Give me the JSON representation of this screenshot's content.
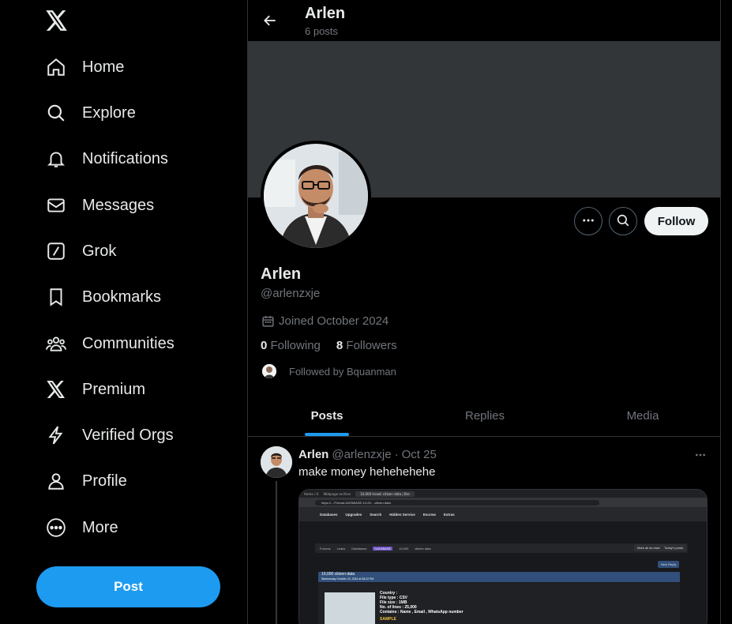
{
  "sidebar": {
    "logo": "x-logo-icon",
    "items": [
      {
        "label": "Home",
        "icon": "home-icon"
      },
      {
        "label": "Explore",
        "icon": "search-icon"
      },
      {
        "label": "Notifications",
        "icon": "bell-icon"
      },
      {
        "label": "Messages",
        "icon": "envelope-icon"
      },
      {
        "label": "Grok",
        "icon": "grok-icon"
      },
      {
        "label": "Bookmarks",
        "icon": "bookmark-icon"
      },
      {
        "label": "Communities",
        "icon": "communities-icon"
      },
      {
        "label": "Premium",
        "icon": "x-logo-icon"
      },
      {
        "label": "Verified Orgs",
        "icon": "lightning-icon"
      },
      {
        "label": "Profile",
        "icon": "person-icon"
      },
      {
        "label": "More",
        "icon": "more-circle-icon"
      }
    ],
    "post_label": "Post"
  },
  "header": {
    "name": "Arlen",
    "posts_count": "6 posts"
  },
  "profile": {
    "name": "Arlen",
    "handle": "@arlenzxje",
    "joined": "Joined October 2024",
    "following_count": "0",
    "following_label": "Following",
    "followers_count": "8",
    "followers_label": "Followers",
    "followed_by": "Followed by Bquanman",
    "follow_label": "Follow"
  },
  "tabs": [
    {
      "label": "Posts",
      "active": true
    },
    {
      "label": "Replies",
      "active": false
    },
    {
      "label": "Media",
      "active": false
    }
  ],
  "tweet": {
    "name": "Arlen",
    "handle": "@arlenzxje",
    "separator": "·",
    "date": "Oct 25",
    "text": "make money hehehehehe"
  },
  "media": {
    "browser_tabs": [
      "Home / X",
      "Webpage archive",
      "10,000 Israeli citizen data | Bre"
    ],
    "url": "https://.../Thread-DATABASE-10-00... citizen-data",
    "nav_items": [
      "Databases",
      "Upgrades",
      "Search",
      "Hidden Service",
      "Escrow",
      "Extras"
    ],
    "breadcrumb": [
      "Forums",
      "Leaks",
      "Databases",
      "DATABASE",
      "10,000",
      "citizen data"
    ],
    "mark_read": "Mark all as read",
    "todays_posts": "Today's posts",
    "new_reply": "New Reply",
    "thread_title": "10,000 citizen data",
    "thread_date": "Wednesday October 23, 2024 at 08:22 PM",
    "info_lines": [
      "Country :",
      "File type : CSV",
      "File size : 1MB",
      "No. of lines : 25,000",
      "Contains : Name , Email , WhatsApp number"
    ],
    "sample": "SAMPLE"
  },
  "colors": {
    "accent": "#1d9bf0",
    "background": "#000000",
    "banner": "#333639",
    "muted": "#71767b"
  }
}
